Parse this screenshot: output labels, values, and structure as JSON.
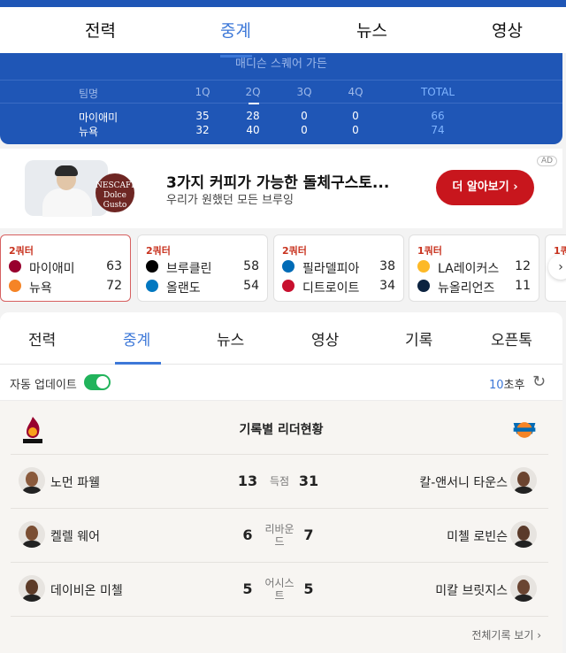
{
  "top_tabs": [
    "전력",
    "중계",
    "뉴스",
    "영상"
  ],
  "board": {
    "venue": "매디슨 스퀘어 가든",
    "headers": [
      "팀명",
      "1Q",
      "2Q",
      "3Q",
      "4Q",
      "TOTAL"
    ],
    "rows": [
      {
        "team": "마이애미",
        "q": [
          "35",
          "28",
          "0",
          "0"
        ],
        "total": "66"
      },
      {
        "team": "뉴욕",
        "q": [
          "32",
          "40",
          "0",
          "0"
        ],
        "total": "74"
      }
    ]
  },
  "ad": {
    "badge": "AD",
    "brand": "NESCAFÉ Dolce Gusto",
    "title": "3가지 커피가 가능한 돌체구스토...",
    "subtitle": "우리가 원했던 모든 브루잉",
    "cta": "더 알아보기 ›"
  },
  "games": [
    {
      "quarter": "2쿼터",
      "teams": [
        {
          "name": "마이애미",
          "score": "63",
          "color": "#98002e"
        },
        {
          "name": "뉴욕",
          "score": "72",
          "color": "#f58426"
        }
      ]
    },
    {
      "quarter": "2쿼터",
      "teams": [
        {
          "name": "브루클린",
          "score": "58",
          "color": "#000000"
        },
        {
          "name": "올랜도",
          "score": "54",
          "color": "#0077c0"
        }
      ]
    },
    {
      "quarter": "2쿼터",
      "teams": [
        {
          "name": "필라델피아",
          "score": "38",
          "color": "#006bb6"
        },
        {
          "name": "디트로이트",
          "score": "34",
          "color": "#c8102e"
        }
      ]
    },
    {
      "quarter": "1쿼터",
      "teams": [
        {
          "name": "LA레이커스",
          "score": "12",
          "color": "#fdb927"
        },
        {
          "name": "뉴올리언즈",
          "score": "11",
          "color": "#0c2340"
        }
      ]
    },
    {
      "quarter": "1쿼",
      "teams": [
        {
          "name": "",
          "score": "",
          "color": "#000000"
        },
        {
          "name": "",
          "score": "",
          "color": "#c8102e"
        }
      ]
    }
  ],
  "main_tabs": [
    "전력",
    "중계",
    "뉴스",
    "영상",
    "기록",
    "오픈톡"
  ],
  "auto_update": {
    "label": "자동 업데이트",
    "seconds": "10",
    "suffix": "초후"
  },
  "leaders": {
    "title": "기록별 리더현황",
    "rows": [
      {
        "left_name": "노먼 파웰",
        "left_val": "13",
        "stat": "득점",
        "right_val": "31",
        "right_name": "칼-앤서니 타운스"
      },
      {
        "left_name": "켈렐 웨어",
        "left_val": "6",
        "stat": "리바운드",
        "right_val": "7",
        "right_name": "미첼 로빈슨"
      },
      {
        "left_name": "데이비온 미첼",
        "left_val": "5",
        "stat": "어시스트",
        "right_val": "5",
        "right_name": "미칼 브릿지스"
      }
    ],
    "more": "전체기록 보기 ›"
  }
}
